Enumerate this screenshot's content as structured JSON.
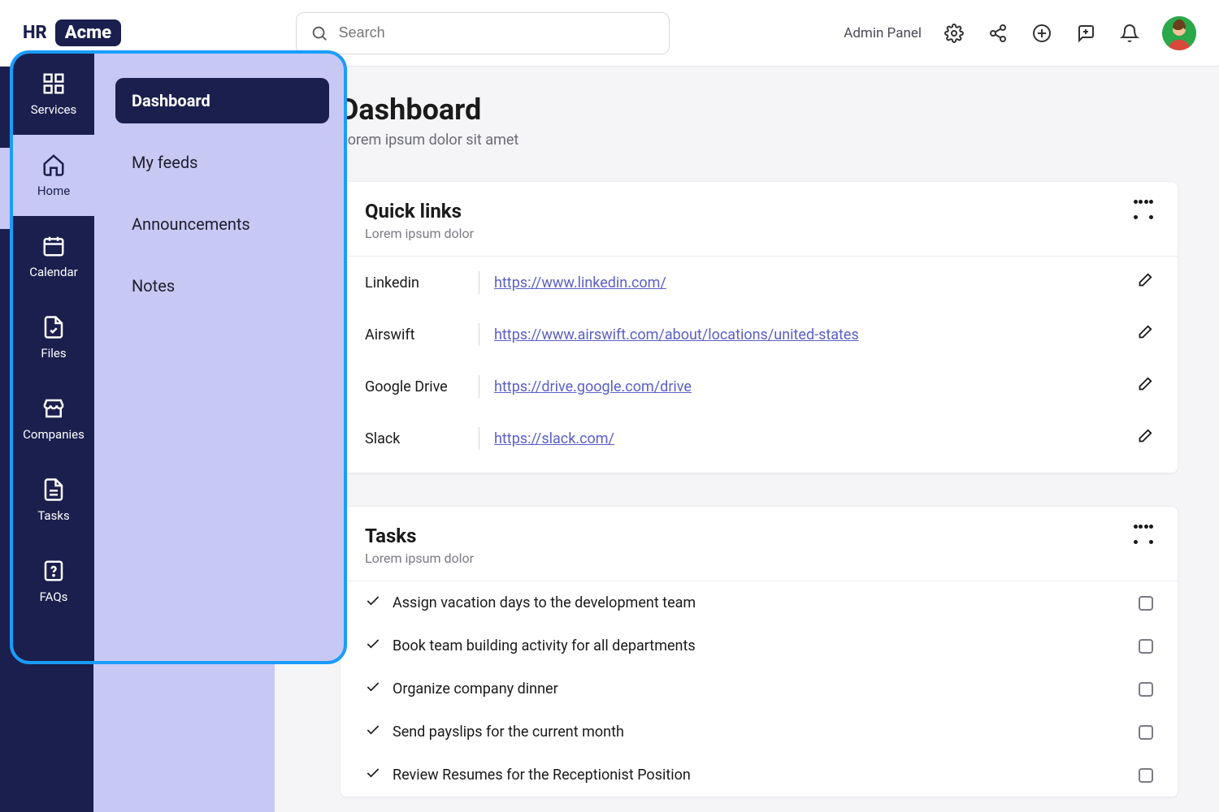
{
  "header": {
    "logo_left": "HR",
    "logo_badge": "Acme",
    "search_placeholder": "Search",
    "admin_label": "Admin Panel"
  },
  "primary_nav": [
    {
      "label": "Services"
    },
    {
      "label": "Home"
    },
    {
      "label": "Calendar"
    },
    {
      "label": "Files"
    },
    {
      "label": "Companies"
    },
    {
      "label": "Tasks"
    },
    {
      "label": "FAQs"
    }
  ],
  "flyout_menu": [
    {
      "label": "Dashboard",
      "active": true
    },
    {
      "label": "My feeds"
    },
    {
      "label": "Announcements"
    },
    {
      "label": "Notes"
    }
  ],
  "page": {
    "title": "Dashboard",
    "subtitle": "Lorem ipsum dolor sit amet"
  },
  "quick_links": {
    "title": "Quick links",
    "subtitle": "Lorem ipsum dolor",
    "rows": [
      {
        "name": "Linkedin",
        "url": "https://www.linkedin.com/"
      },
      {
        "name": "Airswift",
        "url": "https://www.airswift.com/about/locations/united-states"
      },
      {
        "name": "Google Drive",
        "url": "https://drive.google.com/drive"
      },
      {
        "name": "Slack",
        "url": "https://slack.com/"
      }
    ]
  },
  "tasks": {
    "title": "Tasks",
    "subtitle": "Lorem ipsum dolor",
    "rows": [
      {
        "text": "Assign vacation days to the development team"
      },
      {
        "text": "Book team building activity for all departments"
      },
      {
        "text": "Organize company dinner"
      },
      {
        "text": "Send payslips for the current month"
      },
      {
        "text": "Review Resumes for the Receptionist Position"
      }
    ]
  }
}
